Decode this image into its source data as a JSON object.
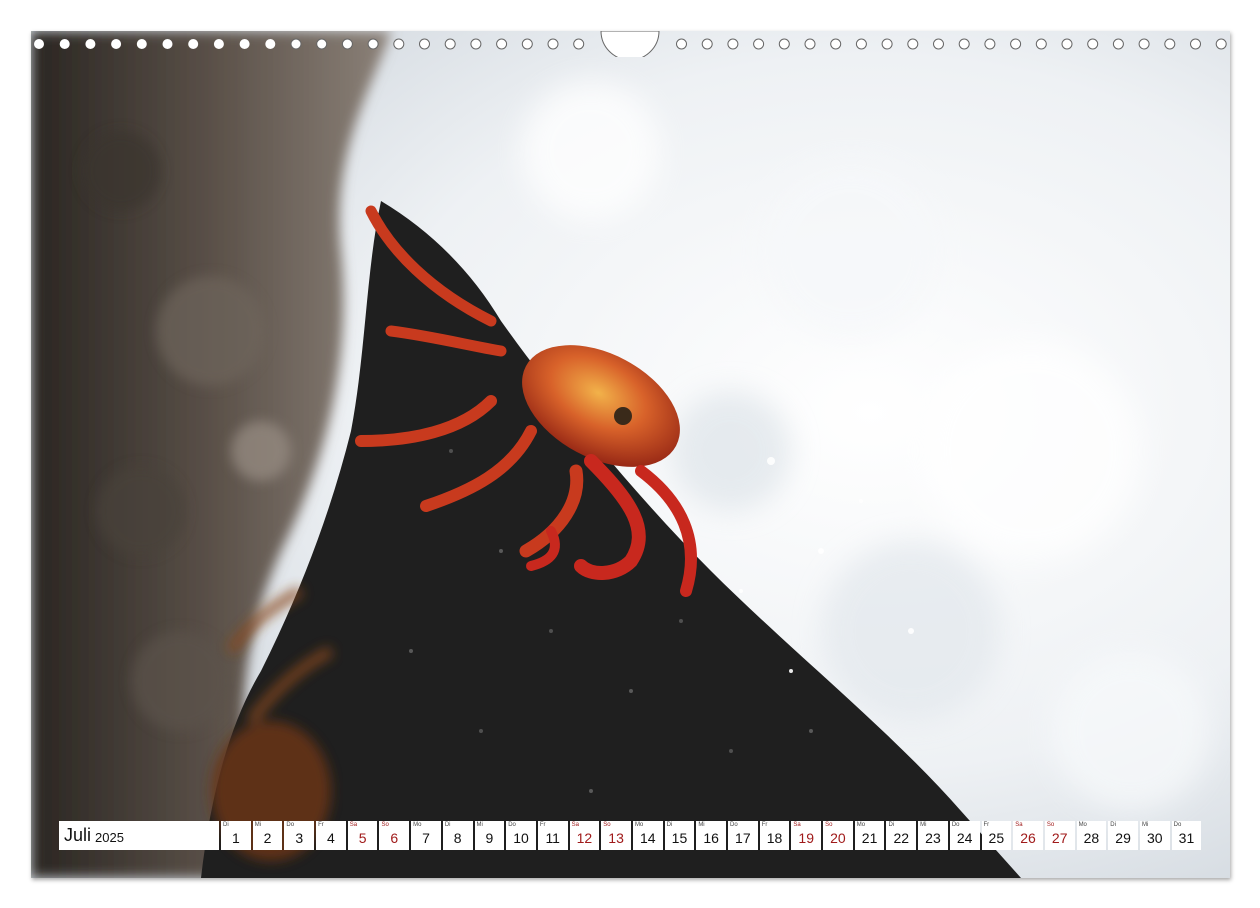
{
  "calendar": {
    "month": "Juli",
    "year": "2025",
    "days": [
      {
        "wd": "Di",
        "num": "1"
      },
      {
        "wd": "Mi",
        "num": "2"
      },
      {
        "wd": "Do",
        "num": "3"
      },
      {
        "wd": "Fr",
        "num": "4"
      },
      {
        "wd": "Sa",
        "num": "5",
        "weekend": true
      },
      {
        "wd": "So",
        "num": "6",
        "weekend": true
      },
      {
        "wd": "Mo",
        "num": "7"
      },
      {
        "wd": "Di",
        "num": "8"
      },
      {
        "wd": "Mi",
        "num": "9"
      },
      {
        "wd": "Do",
        "num": "10"
      },
      {
        "wd": "Fr",
        "num": "11"
      },
      {
        "wd": "Sa",
        "num": "12",
        "weekend": true
      },
      {
        "wd": "So",
        "num": "13",
        "weekend": true
      },
      {
        "wd": "Mo",
        "num": "14"
      },
      {
        "wd": "Di",
        "num": "15"
      },
      {
        "wd": "Mi",
        "num": "16"
      },
      {
        "wd": "Do",
        "num": "17"
      },
      {
        "wd": "Fr",
        "num": "18"
      },
      {
        "wd": "Sa",
        "num": "19",
        "weekend": true
      },
      {
        "wd": "So",
        "num": "20",
        "weekend": true
      },
      {
        "wd": "Mo",
        "num": "21"
      },
      {
        "wd": "Di",
        "num": "22"
      },
      {
        "wd": "Mi",
        "num": "23"
      },
      {
        "wd": "Do",
        "num": "24"
      },
      {
        "wd": "Fr",
        "num": "25"
      },
      {
        "wd": "Sa",
        "num": "26",
        "weekend": true
      },
      {
        "wd": "So",
        "num": "27",
        "weekend": true
      },
      {
        "wd": "Mo",
        "num": "28"
      },
      {
        "wd": "Di",
        "num": "29"
      },
      {
        "wd": "Mi",
        "num": "30"
      },
      {
        "wd": "Do",
        "num": "31"
      }
    ]
  },
  "colors": {
    "weekend": "#a01a1a",
    "rock": "#1f1f1f",
    "crab": "#c83a1e",
    "foam": "#eef1f4"
  },
  "photo": {
    "icons": [
      "crab-icon",
      "rock-icon",
      "sea-foam-icon"
    ]
  }
}
